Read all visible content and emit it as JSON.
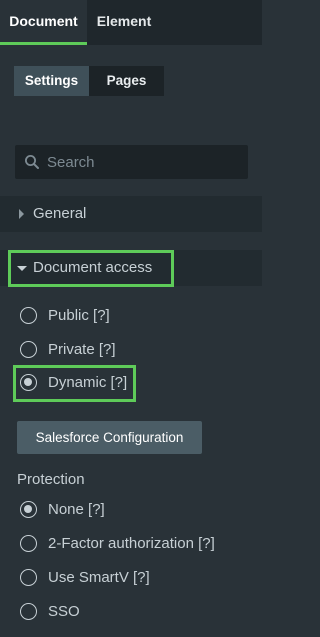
{
  "top_tabs": [
    {
      "label": "Document",
      "active": true
    },
    {
      "label": "Element",
      "active": false
    }
  ],
  "sub_tabs": [
    {
      "label": "Settings",
      "active": true
    },
    {
      "label": "Pages",
      "active": false
    }
  ],
  "search": {
    "placeholder": "Search",
    "value": ""
  },
  "sections": {
    "general": {
      "label": "General",
      "expanded": false
    },
    "document_access": {
      "label": "Document access",
      "expanded": true
    }
  },
  "access_options": [
    {
      "label": "Public [?]",
      "selected": false
    },
    {
      "label": "Private [?]",
      "selected": false
    },
    {
      "label": "Dynamic [?]",
      "selected": true
    }
  ],
  "salesforce_button": {
    "label": "Salesforce Configuration"
  },
  "protection": {
    "label": "Protection",
    "options": [
      {
        "label": "None [?]",
        "selected": true
      },
      {
        "label": "2-Factor authorization [?]",
        "selected": false
      },
      {
        "label": "Use SmartV [?]",
        "selected": false
      },
      {
        "label": "SSO",
        "selected": false
      }
    ]
  },
  "colors": {
    "background": "#293238",
    "highlight": "#5ecb59",
    "active_tab": "#3f5059",
    "button": "#4b5d66"
  }
}
